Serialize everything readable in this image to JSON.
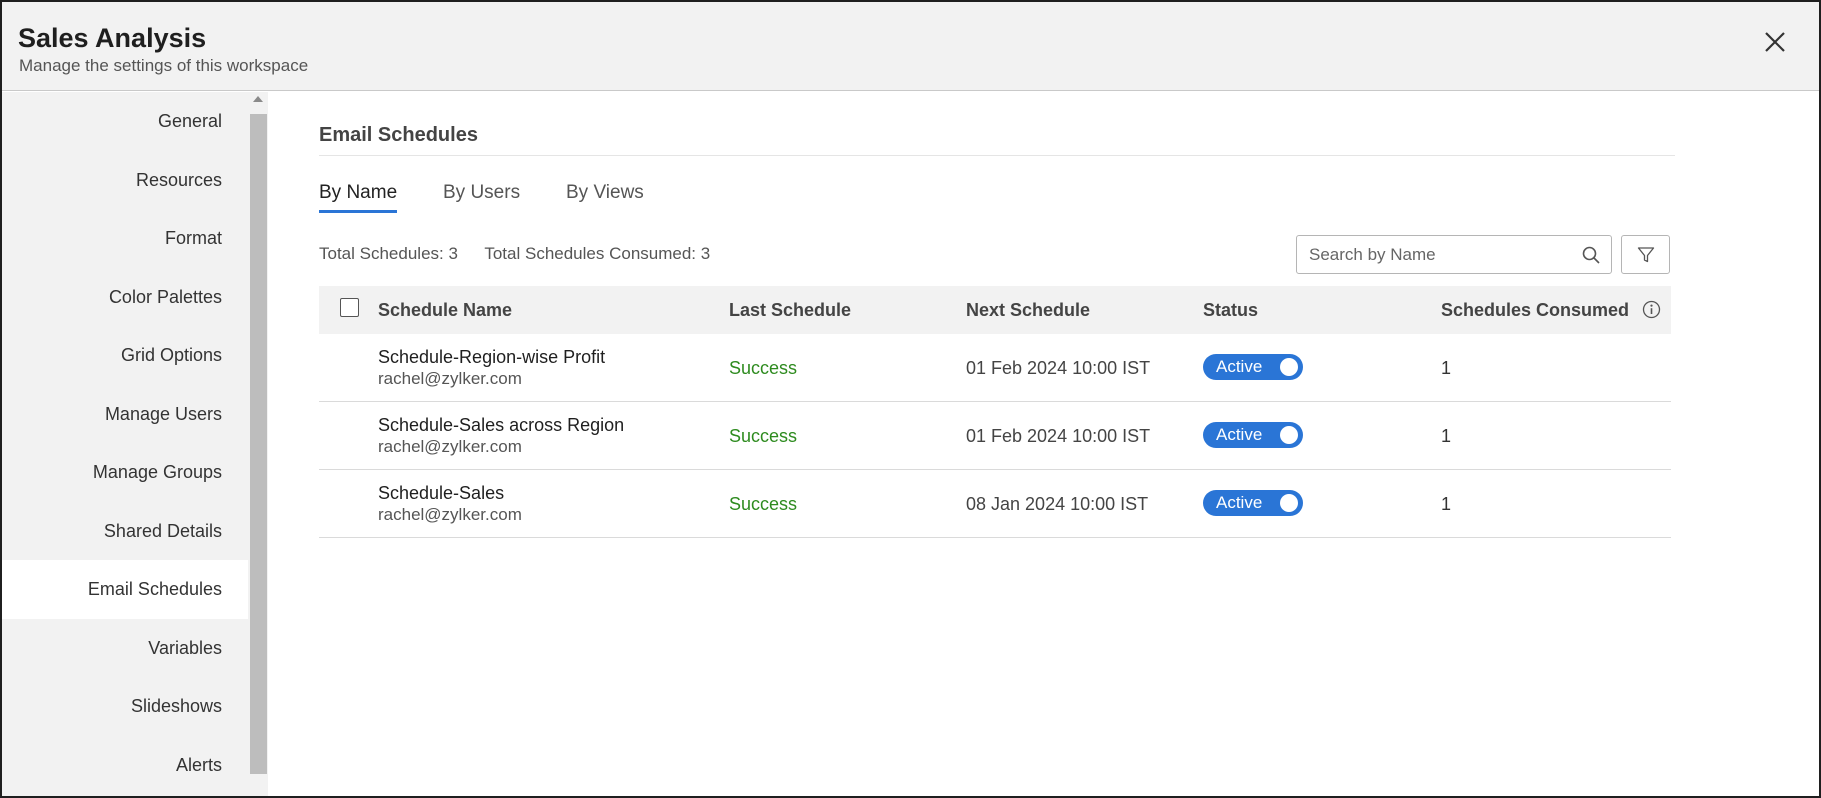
{
  "header": {
    "title": "Sales Analysis",
    "subtitle": "Manage the settings of this workspace"
  },
  "sidebar": {
    "items": [
      {
        "label": "General"
      },
      {
        "label": "Resources"
      },
      {
        "label": "Format"
      },
      {
        "label": "Color Palettes"
      },
      {
        "label": "Grid Options"
      },
      {
        "label": "Manage Users"
      },
      {
        "label": "Manage Groups"
      },
      {
        "label": "Shared Details"
      },
      {
        "label": "Email Schedules"
      },
      {
        "label": "Variables"
      },
      {
        "label": "Slideshows"
      },
      {
        "label": "Alerts"
      }
    ],
    "active": "Email Schedules"
  },
  "main": {
    "section_title": "Email Schedules",
    "tabs": [
      {
        "label": "By Name"
      },
      {
        "label": "By Users"
      },
      {
        "label": "By Views"
      }
    ],
    "active_tab": "By Name",
    "totals": {
      "total_schedules": "Total Schedules: 3",
      "total_consumed": "Total Schedules Consumed: 3"
    },
    "search": {
      "placeholder": "Search by Name",
      "value": ""
    },
    "table": {
      "columns": [
        "Schedule Name",
        "Last Schedule",
        "Next Schedule",
        "Status",
        "Schedules Consumed"
      ],
      "rows": [
        {
          "name": "Schedule-Region-wise Profit",
          "owner": "rachel@zylker.com",
          "last": "Success",
          "next": "01 Feb 2024 10:00 IST",
          "status": "Active",
          "consumed": "1"
        },
        {
          "name": "Schedule-Sales across Region",
          "owner": "rachel@zylker.com",
          "last": "Success",
          "next": "01 Feb 2024 10:00 IST",
          "status": "Active",
          "consumed": "1"
        },
        {
          "name": "Schedule-Sales",
          "owner": "rachel@zylker.com",
          "last": "Success",
          "next": "08 Jan 2024 10:00 IST",
          "status": "Active",
          "consumed": "1"
        }
      ]
    }
  },
  "colors": {
    "accent": "#2a75d6",
    "success": "#2e8b1f",
    "panel": "#f2f2f2"
  },
  "icons": {
    "close": "close-icon",
    "search": "search-icon",
    "filter": "filter-icon",
    "info": "info-icon"
  }
}
